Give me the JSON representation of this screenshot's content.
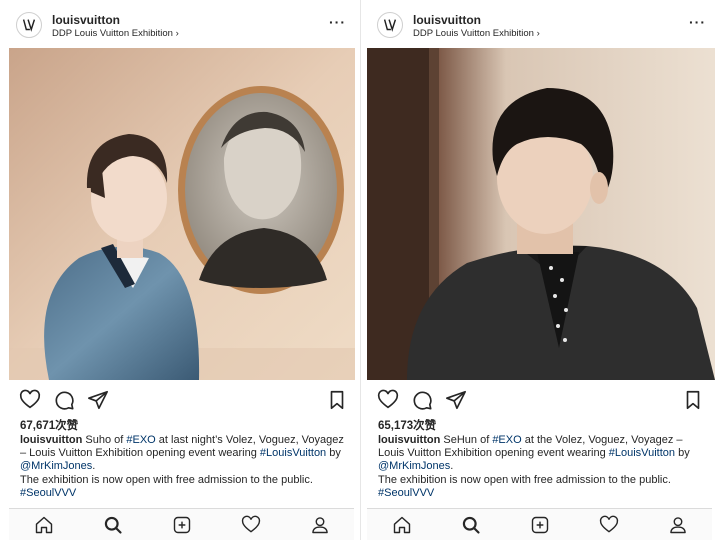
{
  "posts": [
    {
      "username": "louisvuitton",
      "location": "DDP Louis Vuitton Exhibition ›",
      "more": "···",
      "likes": "67,671次赞",
      "caption_user": "louisvuitton",
      "caption_parts": [
        " Suho of ",
        "#EXO",
        " at last night’s Volez, Voguez, Voyagez – Louis Vuitton Exhibition opening event wearing ",
        "#LouisVuitton",
        " by ",
        "@MrKimJones",
        ".",
        "The exhibition is now open with free admission to the public.",
        "#SeoulVVV"
      ]
    },
    {
      "username": "louisvuitton",
      "location": "DDP Louis Vuitton Exhibition ›",
      "more": "···",
      "likes": "65,173次赞",
      "caption_user": "louisvuitton",
      "caption_parts": [
        " SeHun of ",
        "#EXO",
        " at the Volez, Voguez, Voyagez – Louis Vuitton Exhibition opening event wearing ",
        "#LouisVuitton",
        " by ",
        "@MrKimJones",
        ".",
        "The exhibition is now open with free admission to the public.",
        "#SeoulVVV"
      ]
    }
  ],
  "colors": {
    "link": "#003569",
    "text": "#262626",
    "tabbar_bg": "#fafafa"
  },
  "tabs": [
    "home-icon",
    "search-icon",
    "add-post-icon",
    "activity-heart-icon",
    "profile-icon"
  ]
}
